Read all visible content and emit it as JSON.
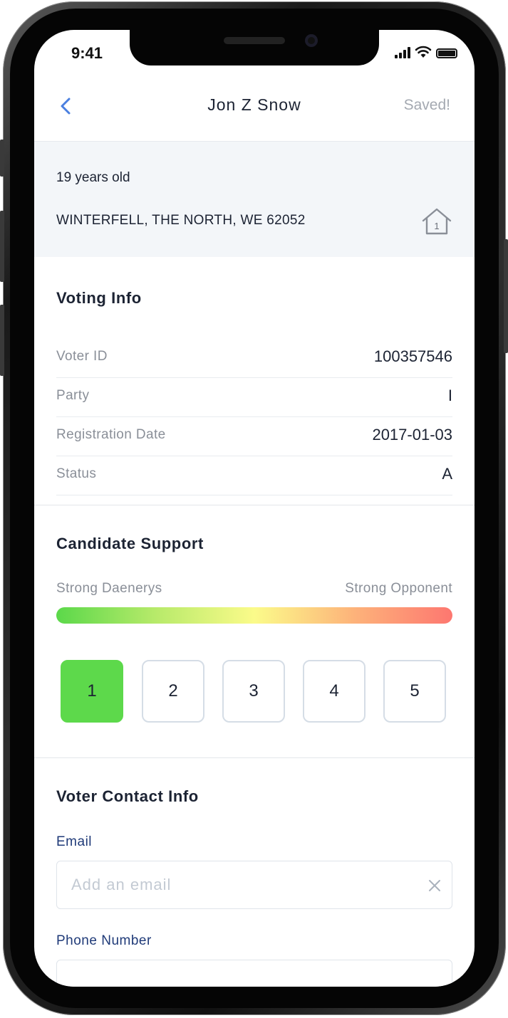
{
  "status_bar": {
    "time": "9:41",
    "signal_icon": "cellular-signal-icon",
    "wifi_icon": "wifi-icon",
    "battery_icon": "battery-icon"
  },
  "nav": {
    "back_icon": "chevron-left-icon",
    "title": "Jon Z Snow",
    "saved_label": "Saved!"
  },
  "profile": {
    "age": "19 years old",
    "address": "WINTERFELL, THE NORTH, WE 62052",
    "household_icon": "home-icon",
    "household_count": "1"
  },
  "voting_info": {
    "title": "Voting Info",
    "rows": [
      {
        "label": "Voter ID",
        "value": "100357546"
      },
      {
        "label": "Party",
        "value": "I"
      },
      {
        "label": "Registration Date",
        "value": "2017-01-03"
      },
      {
        "label": "Status",
        "value": "A"
      }
    ]
  },
  "candidate_support": {
    "title": "Candidate Support",
    "scale_left": "Strong Daenerys",
    "scale_right": "Strong Opponent",
    "options": [
      "1",
      "2",
      "3",
      "4",
      "5"
    ],
    "selected": "1",
    "colors": {
      "selected": "#5dd94b",
      "gradient": [
        "#5bd84a",
        "#fbfb8a",
        "#fd7770"
      ]
    }
  },
  "contact": {
    "title": "Voter Contact Info",
    "email": {
      "label": "Email",
      "value": "",
      "placeholder": "Add an email",
      "clear_icon": "close-icon"
    },
    "phone": {
      "label": "Phone Number",
      "value": "",
      "placeholder": ""
    }
  },
  "colors": {
    "accent": "#4a7fe0",
    "label_blue": "#1f3a78",
    "text_dark": "#1c2333",
    "text_muted": "#8a8f98",
    "band_bg": "#f3f6f9"
  }
}
